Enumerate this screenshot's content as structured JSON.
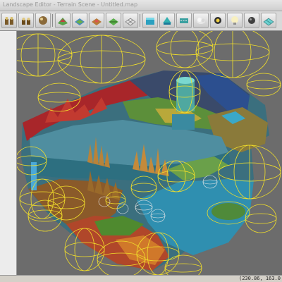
{
  "window": {
    "title": "Landscape Editor - Terrain Scene - Untitled.map"
  },
  "toolbar": {
    "buttons": [
      {
        "name": "weights-tool",
        "icon": "weights-icon"
      },
      {
        "name": "weights-tool-2",
        "icon": "weights-icon"
      },
      {
        "name": "sphere-brush",
        "icon": "sphere-icon"
      },
      {
        "name": "terrain-raise",
        "icon": "terrain-raise-icon"
      },
      {
        "name": "terrain-flatten",
        "icon": "terrain-flatten-icon"
      },
      {
        "name": "terrain-paint",
        "icon": "terrain-paint-icon"
      },
      {
        "name": "terrain-smooth",
        "icon": "terrain-smooth-icon"
      },
      {
        "name": "terrain-grid",
        "icon": "terrain-grid-icon"
      },
      {
        "name": "water-plane",
        "icon": "water-icon"
      },
      {
        "name": "water-fill",
        "icon": "water-fill-icon"
      },
      {
        "name": "road-tool",
        "icon": "road-icon"
      },
      {
        "name": "sky-settings",
        "icon": "sky-icon"
      },
      {
        "name": "light-tool",
        "icon": "light-icon"
      },
      {
        "name": "bulb-tool",
        "icon": "bulb-icon"
      },
      {
        "name": "object-tool",
        "icon": "object-icon"
      },
      {
        "name": "grid-toggle",
        "icon": "grid-icon"
      }
    ]
  },
  "status": {
    "coordinates": "(230.86, 163.0"
  },
  "colors": {
    "viewport_bg": "#6c6c6c",
    "wireframe": "#f2df2a",
    "water": "#2f8fb0",
    "terrain_red": "#b0302a",
    "terrain_orange": "#c8682a",
    "terrain_green": "#4f9a3a"
  }
}
